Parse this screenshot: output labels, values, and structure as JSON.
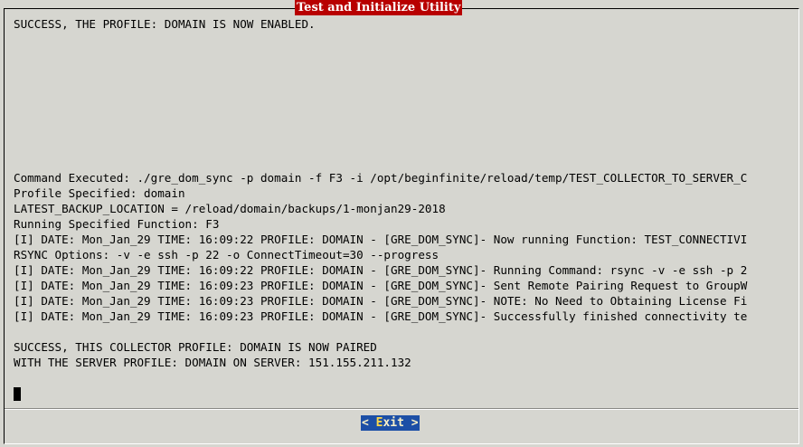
{
  "window": {
    "title": "Test and Initialize Utility"
  },
  "output": {
    "lines": [
      "SUCCESS, THE PROFILE: DOMAIN IS NOW ENABLED.",
      "",
      "",
      "",
      "",
      "",
      "",
      "",
      "",
      "",
      "Command Executed: ./gre_dom_sync -p domain -f F3 -i /opt/beginfinite/reload/temp/TEST_COLLECTOR_TO_SERVER_C",
      "Profile Specified: domain",
      "LATEST_BACKUP_LOCATION = /reload/domain/backups/1-monjan29-2018",
      "Running Specified Function: F3",
      "[I] DATE: Mon_Jan_29 TIME: 16:09:22 PROFILE: DOMAIN - [GRE_DOM_SYNC]- Now running Function: TEST_CONNECTIVI",
      "RSYNC Options: -v -e ssh -p 22 -o ConnectTimeout=30 --progress",
      "[I] DATE: Mon_Jan_29 TIME: 16:09:22 PROFILE: DOMAIN - [GRE_DOM_SYNC]- Running Command: rsync -v -e ssh -p 2",
      "[I] DATE: Mon_Jan_29 TIME: 16:09:23 PROFILE: DOMAIN - [GRE_DOM_SYNC]- Sent Remote Pairing Request to GroupW",
      "[I] DATE: Mon_Jan_29 TIME: 16:09:23 PROFILE: DOMAIN - [GRE_DOM_SYNC]- NOTE: No Need to Obtaining License Fi",
      "[I] DATE: Mon_Jan_29 TIME: 16:09:23 PROFILE: DOMAIN - [GRE_DOM_SYNC]- Successfully finished connectivity te",
      "",
      "SUCCESS, THIS COLLECTOR PROFILE: DOMAIN IS NOW PAIRED",
      "WITH THE SERVER PROFILE: DOMAIN ON SERVER: 151.155.211.132",
      ""
    ]
  },
  "buttons": {
    "exit_open": "< ",
    "exit_hotkey": "E",
    "exit_rest": "xit",
    "exit_close": " >"
  }
}
